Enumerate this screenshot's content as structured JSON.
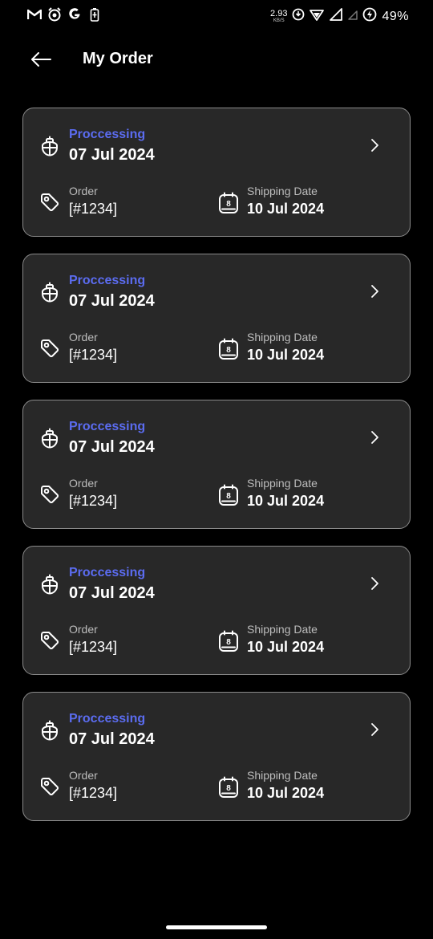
{
  "status_bar": {
    "left_icons": [
      "gmail-icon",
      "alarm-icon",
      "google-icon",
      "battery-saver-icon"
    ],
    "net_speed_value": "2.93",
    "net_speed_unit": "KB/S",
    "battery_percent": "49%"
  },
  "header": {
    "title": "My Order"
  },
  "colors": {
    "accent": "#5b6cf0",
    "card_bg": "#282828",
    "card_border": "#8a8a8a",
    "background": "#000000"
  },
  "orders": [
    {
      "status": "Proccessing",
      "date": "07 Jul 2024",
      "order_label": "Order",
      "order_number": "[#1234]",
      "shipping_label": "Shipping Date",
      "shipping_date": "10 Jul 2024",
      "calendar_day": "8"
    },
    {
      "status": "Proccessing",
      "date": "07 Jul 2024",
      "order_label": "Order",
      "order_number": "[#1234]",
      "shipping_label": "Shipping Date",
      "shipping_date": "10 Jul 2024",
      "calendar_day": "8"
    },
    {
      "status": "Proccessing",
      "date": "07 Jul 2024",
      "order_label": "Order",
      "order_number": "[#1234]",
      "shipping_label": "Shipping Date",
      "shipping_date": "10 Jul 2024",
      "calendar_day": "8"
    },
    {
      "status": "Proccessing",
      "date": "07 Jul 2024",
      "order_label": "Order",
      "order_number": "[#1234]",
      "shipping_label": "Shipping Date",
      "shipping_date": "10 Jul 2024",
      "calendar_day": "8"
    },
    {
      "status": "Proccessing",
      "date": "07 Jul 2024",
      "order_label": "Order",
      "order_number": "[#1234]",
      "shipping_label": "Shipping Date",
      "shipping_date": "10 Jul 2024",
      "calendar_day": "8"
    }
  ]
}
